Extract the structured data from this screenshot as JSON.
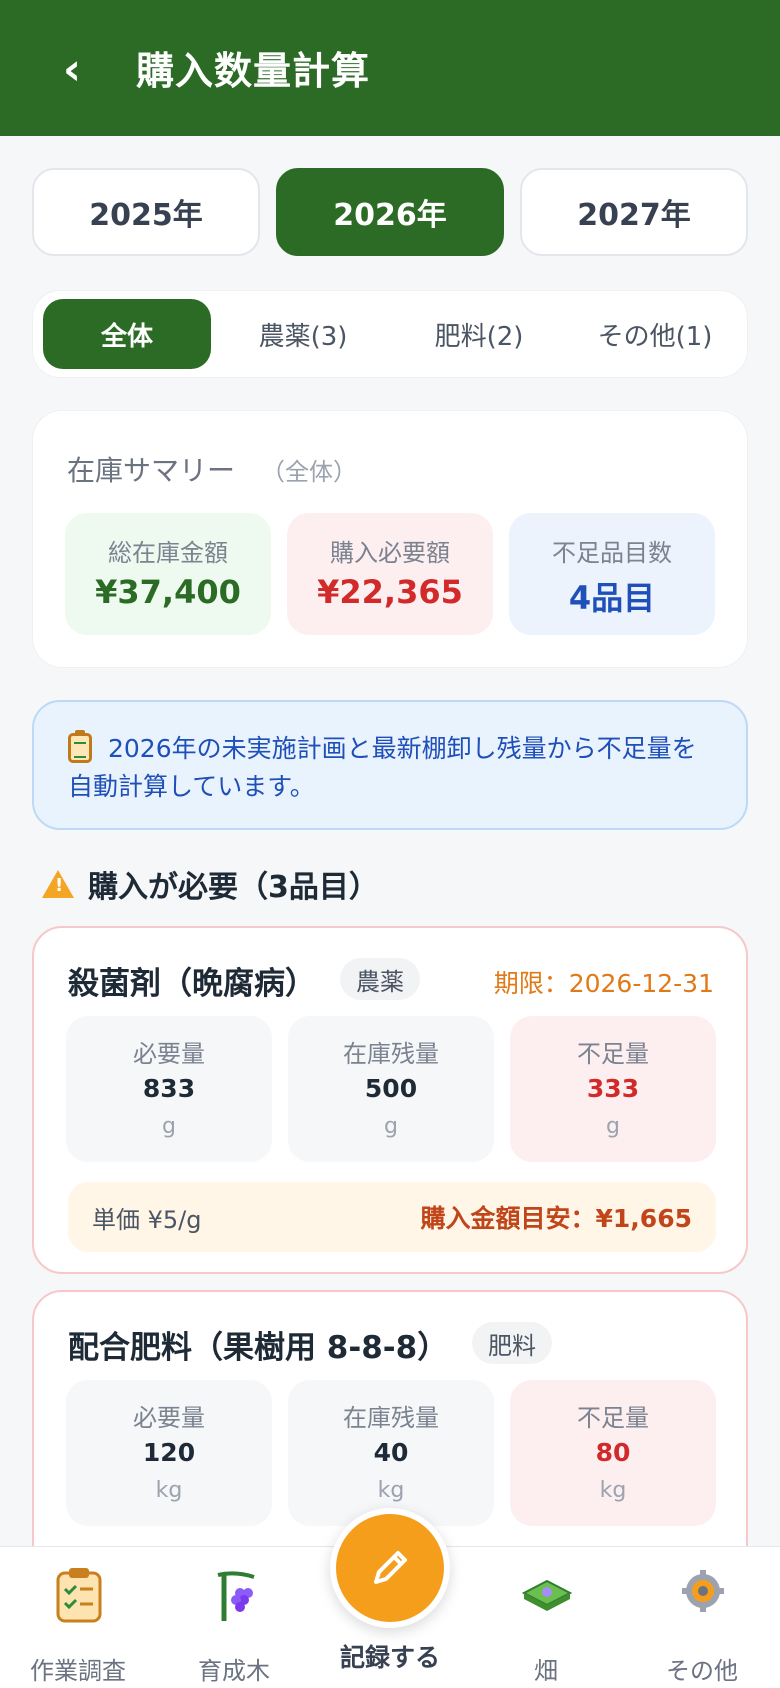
{
  "header": {
    "title": "購入数量計算",
    "back_label": "‹"
  },
  "years": {
    "items": [
      "2025年",
      "2026年",
      "2027年"
    ],
    "selected": "2026年"
  },
  "categories": {
    "items": [
      "全体",
      "農薬(3)",
      "肥料(2)",
      "その他(1)"
    ],
    "selected": "全体"
  },
  "summary": {
    "title": "在庫サマリー",
    "scope": "（全体）",
    "stats": [
      {
        "label": "総在庫金額",
        "value": "¥37,400",
        "color": "#2b6b25",
        "bg": "#eef9ef"
      },
      {
        "label": "購入必要額",
        "value": "¥22,365",
        "color": "#d12a2a",
        "bg": "#fdeff0"
      },
      {
        "label": "不足品目数",
        "value": "4品目",
        "color": "#1f4fb8",
        "bg": "#ecf3fd"
      }
    ]
  },
  "info": {
    "icon": "clipboard-icon",
    "text": "2026年の未実施計画と最新棚卸し残量から不足量を自動計算しています。"
  },
  "section": {
    "icon": "warning-icon",
    "title": "購入が必要（3品目）"
  },
  "items": [
    {
      "name": "殺菌剤（晩腐病）",
      "tag": "農薬",
      "deadline": "期限：2026-12-31",
      "required": {
        "label": "必要量",
        "value": "833",
        "unit": "g"
      },
      "stock": {
        "label": "在庫残量",
        "value": "500",
        "unit": "g"
      },
      "shortage": {
        "label": "不足量",
        "value": "333",
        "unit": "g"
      },
      "unit_price": "単価 ¥5/g",
      "estimate": "購入金額目安：¥1,665"
    },
    {
      "name": "配合肥料（果樹用 8-8-8）",
      "tag": "肥料",
      "required": {
        "label": "必要量",
        "value": "120",
        "unit": "kg"
      },
      "stock": {
        "label": "在庫残量",
        "value": "40",
        "unit": "kg"
      },
      "shortage": {
        "label": "不足量",
        "value": "80",
        "unit": "kg"
      }
    }
  ],
  "nav": {
    "items": [
      {
        "label": "作業調査",
        "icon": "clipboard-check-icon"
      },
      {
        "label": "育成木",
        "icon": "grape-vine-icon"
      },
      {
        "label": "記録する",
        "icon": "pencil-icon"
      },
      {
        "label": "畑",
        "icon": "field-icon"
      },
      {
        "label": "その他",
        "icon": "gear-icon"
      }
    ]
  },
  "colors": {
    "primary": "#2b6b25",
    "accent": "#f59e1b",
    "danger": "#d12a2a"
  }
}
